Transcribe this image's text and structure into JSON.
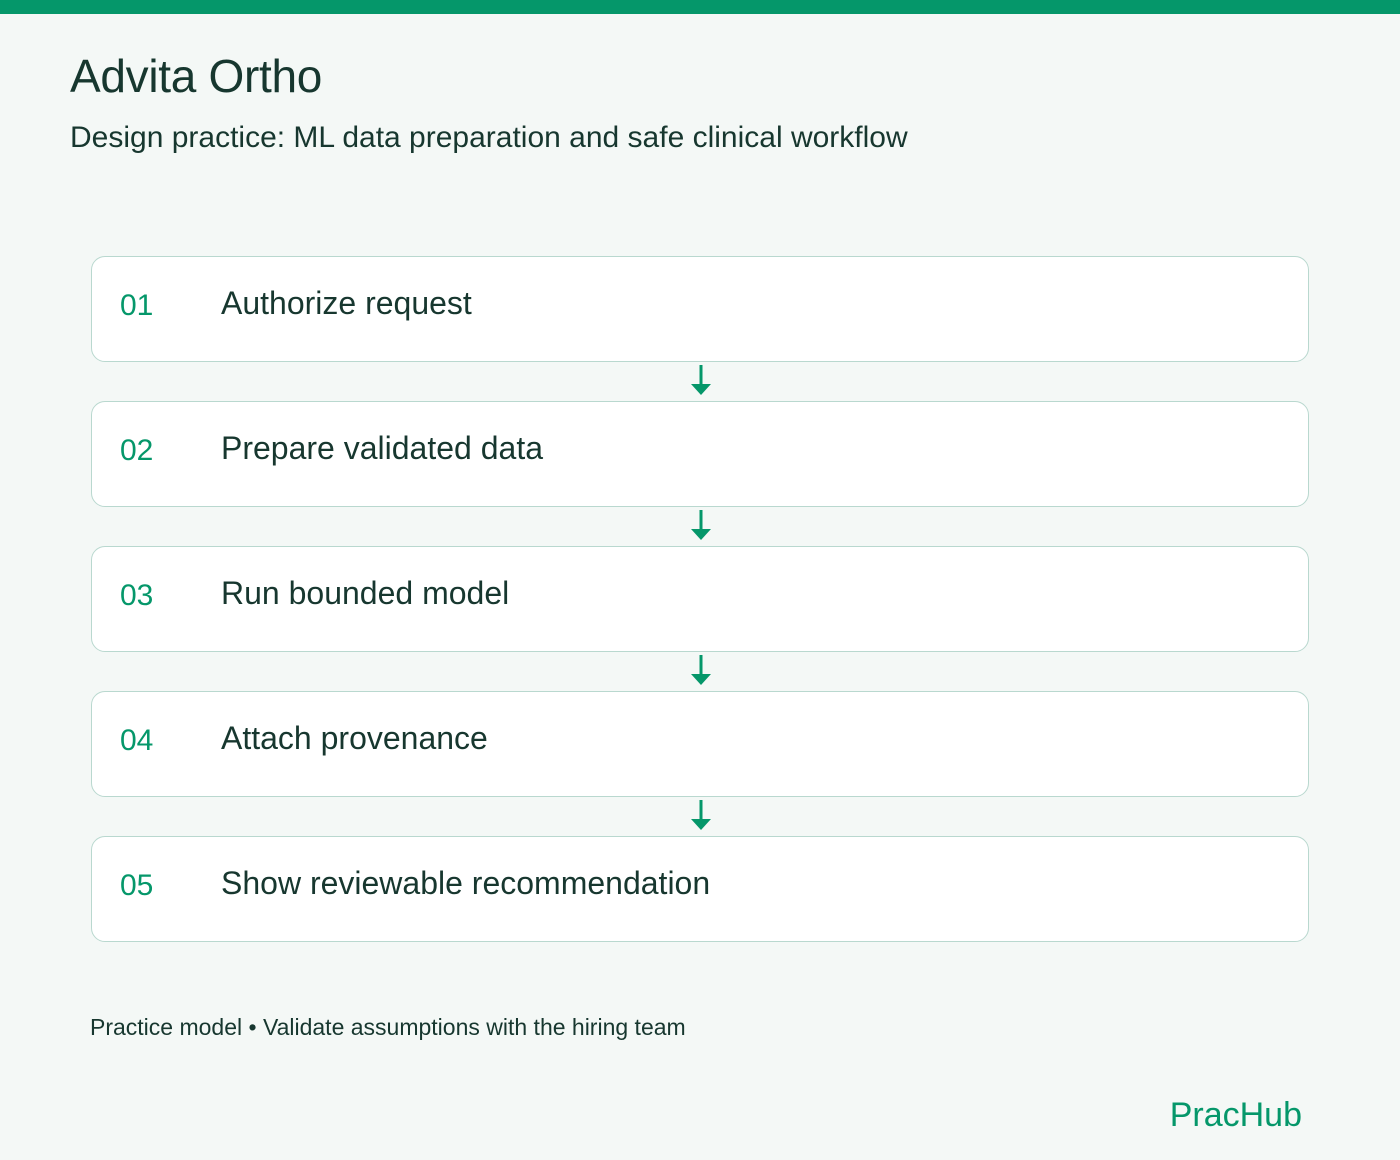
{
  "header": {
    "title": "Advita Ortho",
    "subtitle": "Design practice: ML data preparation and safe clinical workflow"
  },
  "steps": [
    {
      "number": "01",
      "label": "Authorize request"
    },
    {
      "number": "02",
      "label": "Prepare validated data"
    },
    {
      "number": "03",
      "label": "Run bounded model"
    },
    {
      "number": "04",
      "label": "Attach provenance"
    },
    {
      "number": "05",
      "label": "Show reviewable recommendation"
    }
  ],
  "footer": {
    "note": "Practice model • Validate assumptions with the hiring team",
    "brand": "PracHub"
  },
  "colors": {
    "accent": "#05976a",
    "background": "#f4f8f6",
    "card_border": "#b9d8cf",
    "text": "#17372f"
  },
  "icons": {
    "connector": "arrow-down-icon"
  }
}
